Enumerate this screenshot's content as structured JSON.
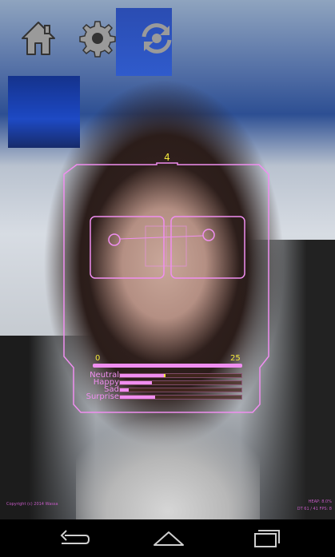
{
  "toolbar": {
    "home_icon": "home-icon",
    "settings_icon": "gear-icon",
    "switch_camera_icon": "camera-switch-icon"
  },
  "hud": {
    "face_count": "4",
    "range_min": "0",
    "range_max": "25",
    "color_accent": "#f08ef0",
    "color_highlight": "#f3e83b",
    "emotions": [
      {
        "label": "Neutral",
        "level": 0.36
      },
      {
        "label": "Happy",
        "level": 0.26
      },
      {
        "label": "Sad",
        "level": 0.07
      },
      {
        "label": "Surprise",
        "level": 0.29
      }
    ]
  },
  "footer": {
    "copyright": "Copyright (c) 2014 Wassa",
    "heap": "HEAP: 8.0%",
    "fps": "DT 61 / 41 FPS: 8"
  },
  "navbar": {
    "back_icon": "back-icon",
    "home_icon": "home-outline-icon",
    "recents_icon": "recents-icon"
  }
}
